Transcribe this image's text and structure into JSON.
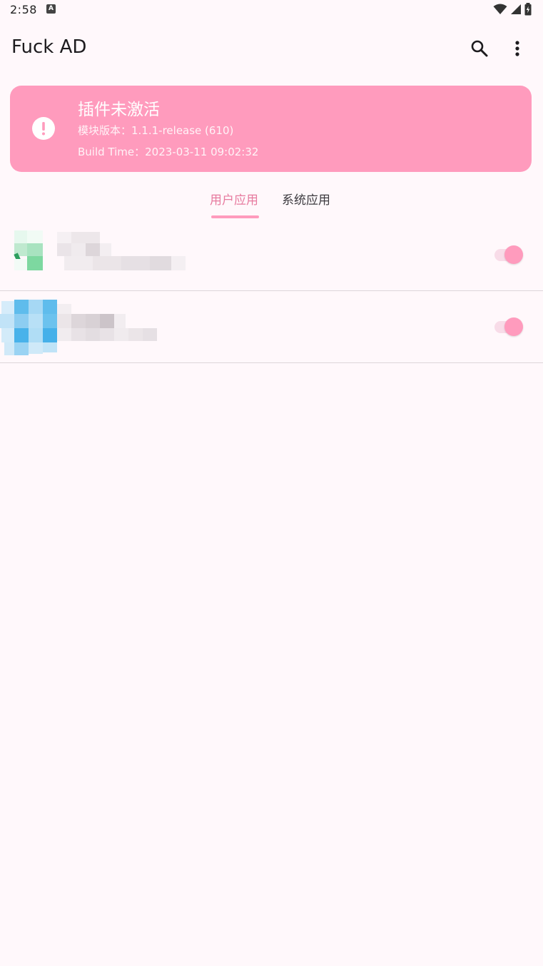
{
  "status_bar": {
    "time": "2:58",
    "notification_icon": "A",
    "icons": [
      "wifi-icon",
      "signal-icon",
      "battery-charging-icon"
    ]
  },
  "app_bar": {
    "title": "Fuck AD",
    "actions": [
      "search-icon",
      "more-vert-icon"
    ]
  },
  "status_card": {
    "icon": "alert-circle-icon",
    "title": "插件未激活",
    "version_line": "模块版本：1.1.1-release (610)",
    "build_line": "Build Time：2023-03-11 09:02:32",
    "color": "#ff9bbd"
  },
  "tabs": [
    {
      "label": "用户应用",
      "selected": true
    },
    {
      "label": "系统应用",
      "selected": false
    }
  ],
  "app_list": [
    {
      "name": "",
      "package": "",
      "enabled": true,
      "icon": "app-icon-green-pixelated"
    },
    {
      "name": "",
      "package": "",
      "enabled": true,
      "icon": "app-icon-blue-pixelated"
    }
  ],
  "colors": {
    "accent": "#ff9bbd",
    "accent_text": "#e77a9f",
    "background": "#fff8fb",
    "divider": "#ddd6da"
  }
}
